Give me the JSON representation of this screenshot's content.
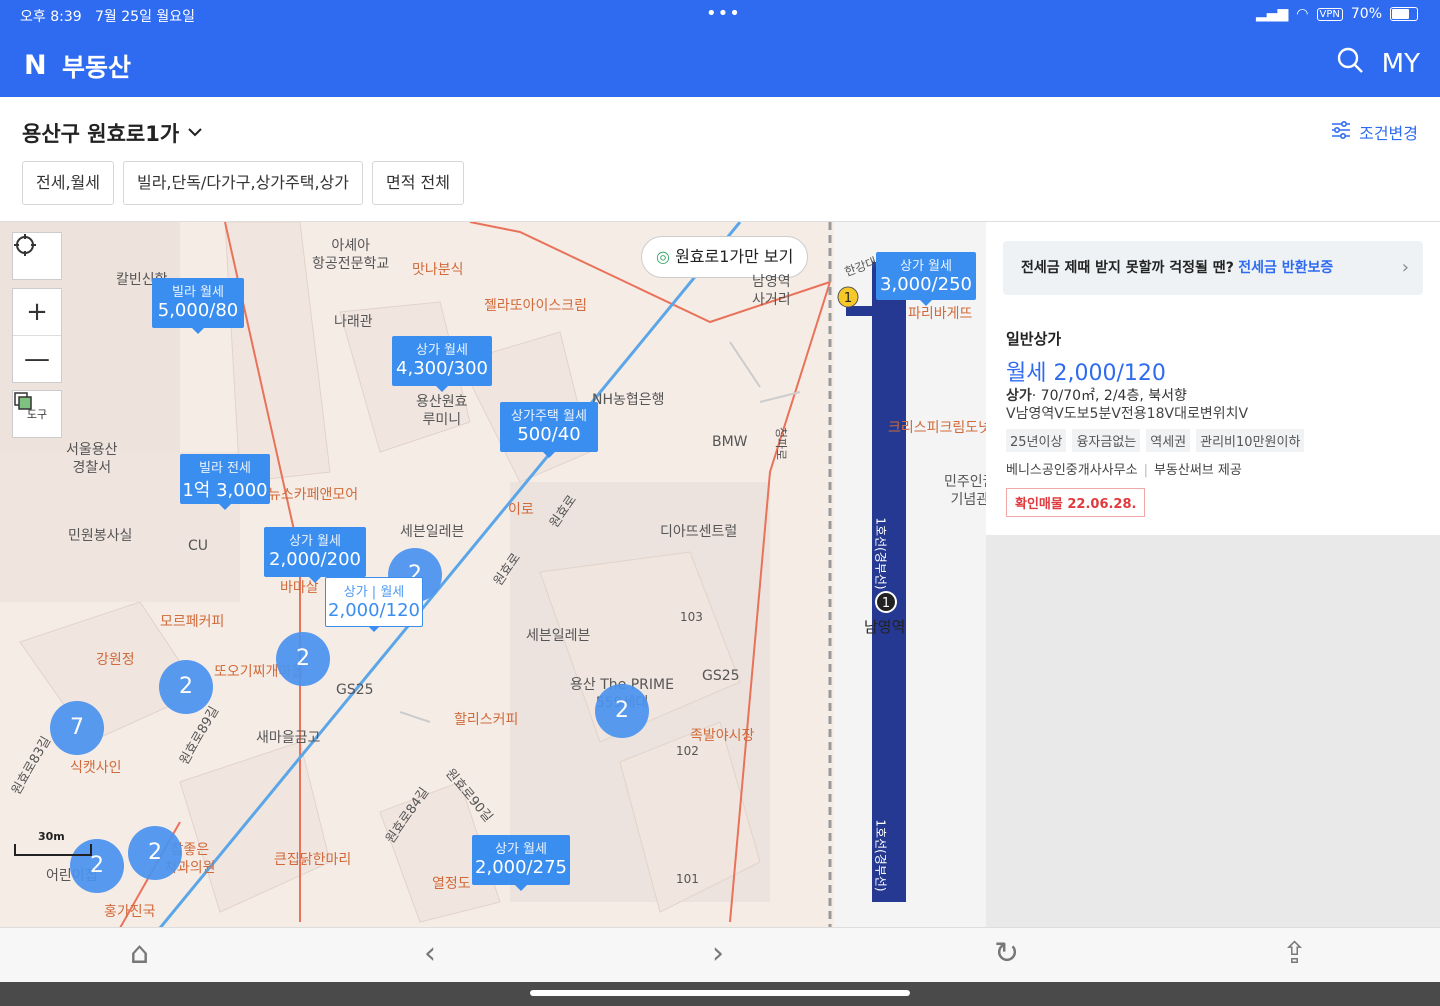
{
  "status": {
    "time": "오후 8:39",
    "date": "7월 25일 월요일",
    "dots": "•••",
    "vpn": "VPN",
    "battery": "70%",
    "battery_level": 0.7
  },
  "header": {
    "logo_letter": "N",
    "title": "부동산",
    "my": "MY"
  },
  "location": {
    "name": "용산구 원효로1가"
  },
  "condition_button": "조건변경",
  "filters": [
    "전세,월세",
    "빌라,단독/다가구,상가주택,상가",
    "면적 전체"
  ],
  "map": {
    "view_only_button": "원효로1가만 보기",
    "tool_label": "도구",
    "scale_label": "30m",
    "markers": [
      {
        "type": "빌라  월세",
        "price": "5,000/80"
      },
      {
        "type": "상가  월세",
        "price": "4,300/300"
      },
      {
        "type": "상가주택  월세",
        "price": "500/40"
      },
      {
        "type": "빌라  전세",
        "price": "1억 3,000"
      },
      {
        "type": "상가  월세",
        "price": "2,000/200"
      },
      {
        "type": "상가 | 월세",
        "price": "2,000/120"
      },
      {
        "type": "상가  월세",
        "price": "2,000/275"
      },
      {
        "type": "상가  월세",
        "price": "3,000/250"
      }
    ],
    "clusters": [
      "2",
      "2",
      "2",
      "7",
      "2",
      "2",
      "2"
    ],
    "places": [
      "아셰아\n항공전문학교",
      "맛나분식",
      "젤라또아이스크림",
      "칼빈신학",
      "나래관",
      "용산원효\n루미니",
      "NH농협은행",
      "남영역\n사거리",
      "서울용산\n경찰서",
      "뉴스카페앤모어",
      "민원봉사실",
      "CU",
      "세븐일레븐",
      "이로",
      "BMW",
      "디아뜨센트럴",
      "모르페커피",
      "강원정",
      "또오기찌개마을",
      "바마살",
      "GS25",
      "세븐일레븐",
      "용산 The PRIME\n559세대",
      "GS25",
      "할리스커피",
      "족발야시장",
      "새마을금고",
      "식캣사인",
      "찹좋은\n치과의원",
      "큰집닭한마리",
      "어린이집",
      "열정도",
      "홍가진국",
      "103",
      "102",
      "101",
      "파리바게뜨",
      "크리스피크림도넛",
      "민주인권\n기념관",
      "남영역",
      "1"
    ],
    "roads": [
      "원효로",
      "원효로",
      "원효로89길",
      "원효로84길",
      "원효로90길",
      "원효로83길",
      "청파로",
      "1호선(경부선)",
      "1호선(경부선)",
      "한강대로"
    ]
  },
  "listing": {
    "banner": {
      "text": "전세금 제때 받지 못할까 걱정될 땐?",
      "link": "전세금 반환보증",
      "arrow": "›"
    },
    "type": "일반상가",
    "price": "월세 2,000/120",
    "spec_bold": "상가",
    "spec": "· 70/70㎡, 2/4층, 북서향",
    "desc": "V남영역V도보5분V전용18V대로변위치V",
    "tags": [
      "25년이상",
      "융자금없는",
      "역세권",
      "관리비10만원이하"
    ],
    "agent": "베니스공인중개사사무소",
    "provider": "부동산써브 제공",
    "confirmed": "확인매물 22.06.28."
  },
  "bottom_bar": {
    "home": "⌂",
    "back": "‹",
    "forward": "›",
    "reload": "↻",
    "share": "⇪"
  }
}
